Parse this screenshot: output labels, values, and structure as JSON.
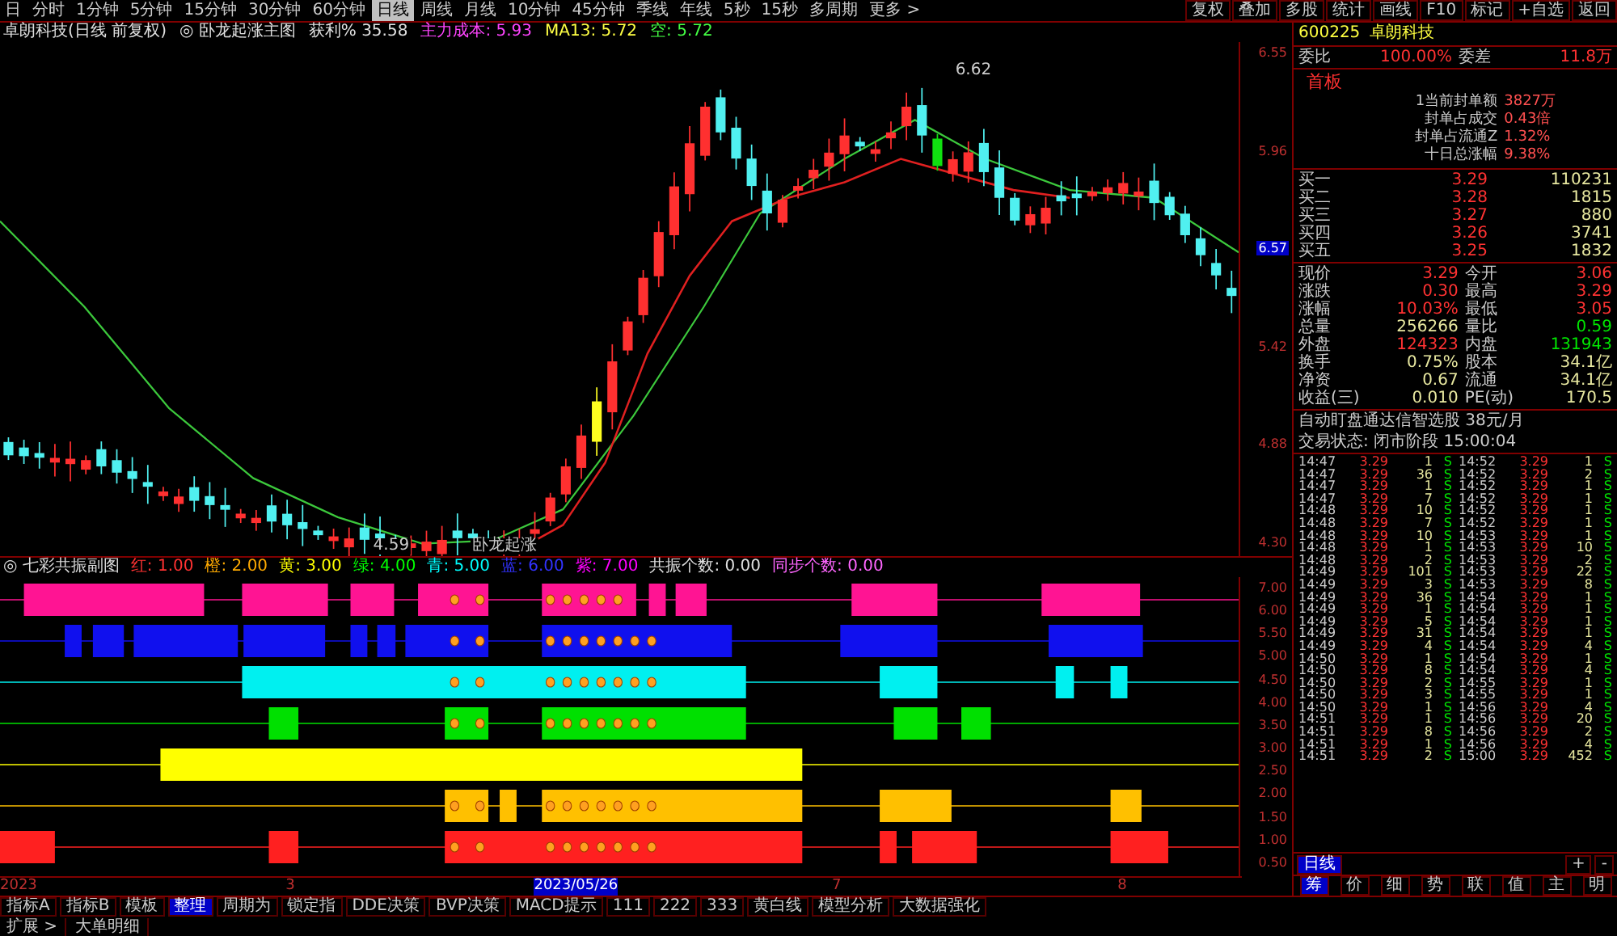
{
  "toolbar": {
    "tabs": [
      {
        "label": "日",
        "selected": false
      },
      {
        "label": "分时",
        "selected": false
      },
      {
        "label": "1分钟",
        "selected": false
      },
      {
        "label": "5分钟",
        "selected": false
      },
      {
        "label": "15分钟",
        "selected": false
      },
      {
        "label": "30分钟",
        "selected": false
      },
      {
        "label": "60分钟",
        "selected": false
      },
      {
        "label": "日线",
        "selected": true
      },
      {
        "label": "周线",
        "selected": false
      },
      {
        "label": "月线",
        "selected": false
      },
      {
        "label": "10分钟",
        "selected": false
      },
      {
        "label": "45分钟",
        "selected": false
      },
      {
        "label": "季线",
        "selected": false
      },
      {
        "label": "年线",
        "selected": false
      },
      {
        "label": "5秒",
        "selected": false
      },
      {
        "label": "15秒",
        "selected": false
      },
      {
        "label": "多周期",
        "selected": false
      },
      {
        "label": "更多 >",
        "selected": false
      }
    ],
    "actions": [
      "复权",
      "叠加",
      "多股",
      "统计",
      "画线",
      "F10",
      "标记",
      "+自选",
      "返回"
    ]
  },
  "main_chart": {
    "info": [
      {
        "text": "卓朗科技(日线 前复权)",
        "color": "#e0e0e0"
      },
      {
        "text": "◎ 卧龙起涨主图",
        "color": "#e0e0e0"
      },
      {
        "text": "获利% 35.58",
        "color": "#e0e0e0"
      },
      {
        "text": "主力成本: 5.93",
        "color": "#ff44ff"
      },
      {
        "text": "MA13: 5.72",
        "color": "#ffff44"
      },
      {
        "text": "空: 5.72",
        "color": "#44ff44"
      }
    ],
    "annotations": [
      "6.62",
      "4.59",
      "卧龙起涨"
    ],
    "price_labels": [
      {
        "text": "6.55",
        "selected": false
      },
      {
        "text": "5.96",
        "selected": false
      },
      {
        "text": "6.57",
        "selected": true
      },
      {
        "text": "5.42",
        "selected": false
      },
      {
        "text": "4.88",
        "selected": false
      },
      {
        "text": "4.30",
        "selected": false
      }
    ]
  },
  "indicator": {
    "title": "◎ 七彩共振副图",
    "legend": [
      {
        "label": "红: 1.00",
        "color": "#ff3232"
      },
      {
        "label": "橙: 2.00",
        "color": "#ffaa00"
      },
      {
        "label": "黄: 3.00",
        "color": "#ffff00"
      },
      {
        "label": "绿: 4.00",
        "color": "#00ff00"
      },
      {
        "label": "青: 5.00",
        "color": "#00ffff"
      },
      {
        "label": "蓝: 6.00",
        "color": "#3232ff"
      },
      {
        "label": "紫: 7.00",
        "color": "#ff00ff"
      },
      {
        "label": "共振个数: 0.00",
        "color": "#e0e0e0"
      },
      {
        "label": "同步个数: 0.00",
        "color": "#ff66ff"
      }
    ],
    "axis": [
      "7.00",
      "6.00",
      "5.50",
      "5.00",
      "4.50",
      "4.00",
      "3.50",
      "3.00",
      "2.50",
      "2.00",
      "1.50",
      "1.00",
      "0.50"
    ]
  },
  "time_axis": [
    {
      "text": "2023",
      "selected": false
    },
    {
      "text": "3",
      "selected": false
    },
    {
      "text": "2023/05/26",
      "selected": true
    },
    {
      "text": "7",
      "selected": false
    },
    {
      "text": "8",
      "selected": false
    }
  ],
  "quote": {
    "code": "600225",
    "name": "卓朗科技",
    "top": [
      {
        "label": "委比",
        "value": "100.00%"
      },
      {
        "label": "委差",
        "value": "11.8万"
      }
    ],
    "board": "首板",
    "stats": [
      {
        "label": "1当前封单额",
        "value": "3827万"
      },
      {
        "label": "封单占成交",
        "value": "0.43倍"
      },
      {
        "label": "封单占流通Z",
        "value": "1.32%"
      },
      {
        "label": "十日总涨幅",
        "value": "9.38%"
      }
    ],
    "bids": [
      {
        "label": "买一",
        "price": "3.29",
        "volume": "110231"
      },
      {
        "label": "买二",
        "price": "3.28",
        "volume": "1815"
      },
      {
        "label": "买三",
        "price": "3.27",
        "volume": "880"
      },
      {
        "label": "买四",
        "price": "3.26",
        "volume": "3741"
      },
      {
        "label": "买五",
        "price": "3.25",
        "volume": "1832"
      }
    ],
    "fields": [
      {
        "label": "现价",
        "value": "3.29",
        "color": "#ff3232"
      },
      {
        "label": "今开",
        "value": "3.06",
        "color": "#ff3232"
      },
      {
        "label": "涨跌",
        "value": "0.30",
        "color": "#ff3232"
      },
      {
        "label": "最高",
        "value": "3.29",
        "color": "#ff3232"
      },
      {
        "label": "涨幅",
        "value": "10.03%",
        "color": "#ff3232"
      },
      {
        "label": "最低",
        "value": "3.05",
        "color": "#ff3232"
      },
      {
        "label": "总量",
        "value": "256266",
        "color": "#e8e8a0"
      },
      {
        "label": "量比",
        "value": "0.59",
        "color": "#00e600"
      },
      {
        "label": "外盘",
        "value": "124323",
        "color": "#ff3232"
      },
      {
        "label": "内盘",
        "value": "131943",
        "color": "#00e600"
      },
      {
        "label": "换手",
        "value": "0.75%",
        "color": "#e8e8a0"
      },
      {
        "label": "股本",
        "value": "34.1亿",
        "color": "#e8e8a0"
      },
      {
        "label": "净资",
        "value": "0.67",
        "color": "#e8e8a0"
      },
      {
        "label": "流通",
        "value": "34.1亿",
        "color": "#e8e8a0"
      },
      {
        "label": "收益(三)",
        "value": "0.010",
        "color": "#e8e8a0"
      },
      {
        "label": "PE(动)",
        "value": "170.5",
        "color": "#e8e8a0"
      }
    ],
    "notice": "自动盯盘通达信智选股 38元/月",
    "status": "交易状态: 闭市阶段 15:00:04"
  },
  "trades": [
    {
      "time": "14:47",
      "price": "3.29",
      "volume": "1",
      "side": "S"
    },
    {
      "time": "14:47",
      "price": "3.29",
      "volume": "36",
      "side": "S"
    },
    {
      "time": "14:47",
      "price": "3.29",
      "volume": "1",
      "side": "S"
    },
    {
      "time": "14:47",
      "price": "3.29",
      "volume": "7",
      "side": "S"
    },
    {
      "time": "14:48",
      "price": "3.29",
      "volume": "10",
      "side": "S"
    },
    {
      "time": "14:48",
      "price": "3.29",
      "volume": "7",
      "side": "S"
    },
    {
      "time": "14:48",
      "price": "3.29",
      "volume": "10",
      "side": "S"
    },
    {
      "time": "14:48",
      "price": "3.29",
      "volume": "1",
      "side": "S"
    },
    {
      "time": "14:48",
      "price": "3.29",
      "volume": "2",
      "side": "S"
    },
    {
      "time": "14:49",
      "price": "3.29",
      "volume": "101",
      "side": "S"
    },
    {
      "time": "14:49",
      "price": "3.29",
      "volume": "3",
      "side": "S"
    },
    {
      "time": "14:49",
      "price": "3.29",
      "volume": "36",
      "side": "S"
    },
    {
      "time": "14:49",
      "price": "3.29",
      "volume": "1",
      "side": "S"
    },
    {
      "time": "14:49",
      "price": "3.29",
      "volume": "5",
      "side": "S"
    },
    {
      "time": "14:49",
      "price": "3.29",
      "volume": "31",
      "side": "S"
    },
    {
      "time": "14:49",
      "price": "3.29",
      "volume": "4",
      "side": "S"
    },
    {
      "time": "14:50",
      "price": "3.29",
      "volume": "1",
      "side": "S"
    },
    {
      "time": "14:50",
      "price": "3.29",
      "volume": "8",
      "side": "S"
    },
    {
      "time": "14:50",
      "price": "3.29",
      "volume": "2",
      "side": "S"
    },
    {
      "time": "14:50",
      "price": "3.29",
      "volume": "3",
      "side": "S"
    },
    {
      "time": "14:50",
      "price": "3.29",
      "volume": "1",
      "side": "S"
    },
    {
      "time": "14:51",
      "price": "3.29",
      "volume": "1",
      "side": "S"
    },
    {
      "time": "14:51",
      "price": "3.29",
      "volume": "8",
      "side": "S"
    },
    {
      "time": "14:51",
      "price": "3.29",
      "volume": "1",
      "side": "S"
    },
    {
      "time": "14:51",
      "price": "3.29",
      "volume": "2",
      "side": "S"
    },
    {
      "time": "14:52",
      "price": "3.29",
      "volume": "1",
      "side": "S"
    },
    {
      "time": "14:52",
      "price": "3.29",
      "volume": "2",
      "side": "S"
    },
    {
      "time": "14:52",
      "price": "3.29",
      "volume": "1",
      "side": "S"
    },
    {
      "time": "14:52",
      "price": "3.29",
      "volume": "1",
      "side": "S"
    },
    {
      "time": "14:52",
      "price": "3.29",
      "volume": "1",
      "side": "S"
    },
    {
      "time": "14:52",
      "price": "3.29",
      "volume": "1",
      "side": "S"
    },
    {
      "time": "14:53",
      "price": "3.29",
      "volume": "1",
      "side": "S"
    },
    {
      "time": "14:53",
      "price": "3.29",
      "volume": "10",
      "side": "S"
    },
    {
      "time": "14:53",
      "price": "3.29",
      "volume": "2",
      "side": "S"
    },
    {
      "time": "14:53",
      "price": "3.29",
      "volume": "22",
      "side": "S"
    },
    {
      "time": "14:53",
      "price": "3.29",
      "volume": "8",
      "side": "S"
    },
    {
      "time": "14:54",
      "price": "3.29",
      "volume": "1",
      "side": "S"
    },
    {
      "time": "14:54",
      "price": "3.29",
      "volume": "1",
      "side": "S"
    },
    {
      "time": "14:54",
      "price": "3.29",
      "volume": "1",
      "side": "S"
    },
    {
      "time": "14:54",
      "price": "3.29",
      "volume": "1",
      "side": "S"
    },
    {
      "time": "14:54",
      "price": "3.29",
      "volume": "4",
      "side": "S"
    },
    {
      "time": "14:54",
      "price": "3.29",
      "volume": "1",
      "side": "S"
    },
    {
      "time": "14:54",
      "price": "3.29",
      "volume": "4",
      "side": "S"
    },
    {
      "time": "14:55",
      "price": "3.29",
      "volume": "1",
      "side": "S"
    },
    {
      "time": "14:55",
      "price": "3.29",
      "volume": "1",
      "side": "S"
    },
    {
      "time": "14:56",
      "price": "3.29",
      "volume": "4",
      "side": "S"
    },
    {
      "time": "14:56",
      "price": "3.29",
      "volume": "20",
      "side": "S"
    },
    {
      "time": "14:56",
      "price": "3.29",
      "volume": "2",
      "side": "S"
    },
    {
      "time": "14:56",
      "price": "3.29",
      "volume": "4",
      "side": "S"
    },
    {
      "time": "15:00",
      "price": "3.29",
      "volume": "452",
      "side": "S"
    }
  ],
  "side_tabs": [
    {
      "label": "日线",
      "selected": true
    }
  ],
  "side_buttons": [
    "+",
    "-"
  ],
  "panel_tabs": [
    {
      "label": "筹",
      "selected": true
    },
    {
      "label": "价",
      "selected": false
    },
    {
      "label": "细",
      "selected": false
    },
    {
      "label": "势",
      "selected": false
    },
    {
      "label": "联",
      "selected": false
    },
    {
      "label": "值",
      "selected": false
    },
    {
      "label": "主",
      "selected": false
    },
    {
      "label": "明",
      "selected": false
    }
  ],
  "bottom_toolbar": [
    {
      "label": "指标A",
      "selected": false
    },
    {
      "label": "指标B",
      "selected": false
    },
    {
      "label": "模板",
      "selected": false
    },
    {
      "label": "整理",
      "selected": true
    },
    {
      "label": "周期为",
      "selected": false
    },
    {
      "label": "锁定指",
      "selected": false
    },
    {
      "label": "DDE决策",
      "selected": false
    },
    {
      "label": "BVP决策",
      "selected": false
    },
    {
      "label": "MACD提示",
      "selected": false
    },
    {
      "label": "111",
      "selected": false
    },
    {
      "label": "222",
      "selected": false
    },
    {
      "label": "333",
      "selected": false
    },
    {
      "label": "黄白线",
      "selected": false
    },
    {
      "label": "模型分析",
      "selected": false
    },
    {
      "label": "大数据强化",
      "selected": false
    }
  ],
  "status_bar": [
    "扩展 >",
    "大单明细"
  ]
}
